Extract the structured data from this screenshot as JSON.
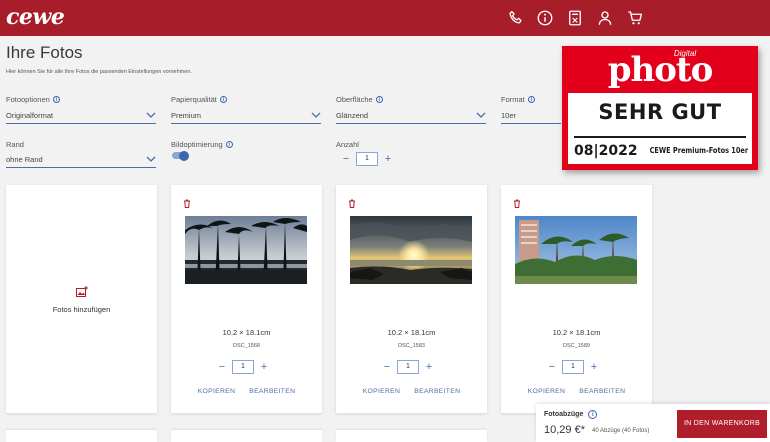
{
  "header": {
    "logo": "cewe",
    "icons": [
      "phone-icon",
      "info-icon",
      "calculator-icon",
      "user-icon",
      "cart-icon"
    ]
  },
  "page": {
    "title": "Ihre Fotos",
    "subtitle": "Hier können Sie für alle Ihre Fotos die passenden Einstellungen vornehmen."
  },
  "options": {
    "format_options": {
      "label": "Fotooptionen",
      "value": "Originalformat"
    },
    "paper_quality": {
      "label": "Papierqualität",
      "value": "Premium"
    },
    "surface": {
      "label": "Oberfläche",
      "value": "Glänzend"
    },
    "format": {
      "label": "Format",
      "value": "10er"
    },
    "border": {
      "label": "Rand",
      "value": "ohne Rand"
    },
    "optimization": {
      "label": "Bildoptimierung",
      "enabled": true
    },
    "quantity": {
      "label": "Anzahl",
      "value": "1"
    }
  },
  "add_card": {
    "label": "Fotos hinzufügen"
  },
  "photos": [
    {
      "size": "10.2 × 18.1cm",
      "filename": "DSC_1568",
      "quantity": "1",
      "copy_label": "KOPIEREN",
      "edit_label": "BEARBEITEN"
    },
    {
      "size": "10.2 × 18.1cm",
      "filename": "DSC_1583",
      "quantity": "1",
      "copy_label": "KOPIEREN",
      "edit_label": "BEARBEITEN"
    },
    {
      "size": "10.2 × 18.1cm",
      "filename": "DSC_1589",
      "quantity": "1",
      "copy_label": "KOPIEREN",
      "edit_label": "BEARBEITEN"
    }
  ],
  "stepper": {
    "minus": "−",
    "plus": "+"
  },
  "badge": {
    "digital": "Digital",
    "brand": "photo",
    "rating": "SEHR GUT",
    "date": "08|2022",
    "product": "CEWE Premium-Fotos 10er"
  },
  "summary": {
    "label": "Fotoabzüge",
    "price": "10,29 €*",
    "count": "40 Abzüge (40 Fotos)",
    "cart_button": "IN DEN WARENKORB"
  },
  "colors": {
    "brand": "#a71d2a",
    "accent": "#4a6fa5",
    "badge": "#e3001b"
  }
}
